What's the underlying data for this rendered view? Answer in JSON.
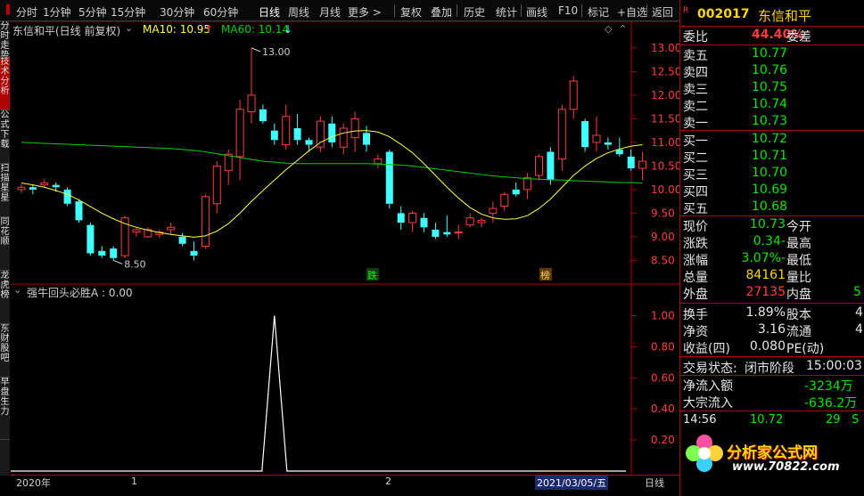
{
  "toolbar": {
    "items": [
      "分时",
      "1分钟",
      "5分钟",
      "15分钟",
      "30分钟",
      "60分钟",
      "日线",
      "周线",
      "月线",
      "更多 >",
      "复权",
      "叠加",
      "历史",
      "统计",
      "画线",
      "F10",
      "标记",
      "+自选",
      "返回"
    ],
    "active": "日线"
  },
  "sidebar": {
    "tabs": [
      "分时走势",
      "技术分析",
      "公式下载",
      "扫描星星",
      "同花顺",
      "龙虎榜",
      "东财股吧",
      "早盘生力"
    ]
  },
  "chart": {
    "title": "东信和平(日线 前复权)",
    "ma10_label": "MA10: 10.95",
    "ma10_arrow": "↑",
    "ma60_label": "MA60: 10.14",
    "ma60_arrow": "↓",
    "high_mark": "13.00",
    "low_mark": "8.50",
    "badge_die": "跌",
    "badge_bang": "榜",
    "y_ticks": [
      "13.00",
      "12.50",
      "12.00",
      "11.50",
      "11.00",
      "10.50",
      "10.00",
      "9.50",
      "9.00",
      "8.50"
    ],
    "indicator_title": "强牛回头必胜A : 0.00",
    "indicator_ticks": [
      "1.00",
      "0.80",
      "0.60",
      "0.40",
      "0.20"
    ],
    "bottom_labels": {
      "year": "2020年",
      "m1": "1",
      "m2": "2",
      "date": "2021/03/05/五",
      "period": "日线"
    },
    "colors": {
      "up": "#ff3c3c",
      "down": "#40ffff",
      "ma10": "#ffff40",
      "ma60": "#00d000"
    }
  },
  "chart_data": {
    "type": "candlestick",
    "ylim": [
      8.3,
      13.3
    ],
    "candles": [
      {
        "o": 10.0,
        "h": 10.12,
        "l": 9.93,
        "c": 10.05
      },
      {
        "o": 10.05,
        "h": 10.1,
        "l": 9.9,
        "c": 10.0
      },
      {
        "o": 10.1,
        "h": 10.22,
        "l": 10.05,
        "c": 10.14
      },
      {
        "o": 10.1,
        "h": 10.15,
        "l": 9.95,
        "c": 10.05
      },
      {
        "o": 10.0,
        "h": 10.05,
        "l": 9.65,
        "c": 9.7
      },
      {
        "o": 9.75,
        "h": 9.8,
        "l": 9.3,
        "c": 9.35
      },
      {
        "o": 9.25,
        "h": 9.3,
        "l": 8.6,
        "c": 8.65
      },
      {
        "o": 8.7,
        "h": 8.8,
        "l": 8.55,
        "c": 8.6
      },
      {
        "o": 8.75,
        "h": 8.8,
        "l": 8.5,
        "c": 8.55
      },
      {
        "o": 8.6,
        "h": 9.45,
        "l": 8.55,
        "c": 9.4
      },
      {
        "o": 9.1,
        "h": 9.2,
        "l": 9.0,
        "c": 9.15
      },
      {
        "o": 9.0,
        "h": 9.2,
        "l": 8.98,
        "c": 9.15
      },
      {
        "o": 9.05,
        "h": 9.15,
        "l": 8.98,
        "c": 9.1
      },
      {
        "o": 9.15,
        "h": 9.3,
        "l": 9.05,
        "c": 9.2
      },
      {
        "o": 9.0,
        "h": 9.08,
        "l": 8.8,
        "c": 8.85
      },
      {
        "o": 8.7,
        "h": 8.9,
        "l": 8.5,
        "c": 8.6
      },
      {
        "o": 8.8,
        "h": 9.9,
        "l": 8.75,
        "c": 9.85
      },
      {
        "o": 9.7,
        "h": 10.6,
        "l": 9.5,
        "c": 10.5
      },
      {
        "o": 10.4,
        "h": 10.85,
        "l": 10.1,
        "c": 10.75
      },
      {
        "o": 10.7,
        "h": 11.9,
        "l": 10.2,
        "c": 11.7
      },
      {
        "o": 11.65,
        "h": 13.0,
        "l": 11.4,
        "c": 12.0
      },
      {
        "o": 11.7,
        "h": 11.8,
        "l": 11.4,
        "c": 11.45
      },
      {
        "o": 11.25,
        "h": 11.4,
        "l": 10.95,
        "c": 11.05
      },
      {
        "o": 10.95,
        "h": 11.8,
        "l": 10.85,
        "c": 11.55
      },
      {
        "o": 11.3,
        "h": 11.6,
        "l": 10.95,
        "c": 11.05
      },
      {
        "o": 11.05,
        "h": 11.1,
        "l": 10.8,
        "c": 10.95
      },
      {
        "o": 10.9,
        "h": 11.55,
        "l": 10.8,
        "c": 11.45
      },
      {
        "o": 11.4,
        "h": 11.55,
        "l": 10.9,
        "c": 11.0
      },
      {
        "o": 10.9,
        "h": 11.4,
        "l": 10.75,
        "c": 11.3
      },
      {
        "o": 11.1,
        "h": 11.65,
        "l": 10.8,
        "c": 11.5
      },
      {
        "o": 11.2,
        "h": 11.35,
        "l": 10.8,
        "c": 10.95
      },
      {
        "o": 10.55,
        "h": 10.75,
        "l": 10.45,
        "c": 10.65
      },
      {
        "o": 10.8,
        "h": 10.85,
        "l": 9.6,
        "c": 9.7
      },
      {
        "o": 9.5,
        "h": 9.65,
        "l": 9.15,
        "c": 9.3
      },
      {
        "o": 9.3,
        "h": 9.55,
        "l": 9.1,
        "c": 9.5
      },
      {
        "o": 9.4,
        "h": 9.5,
        "l": 9.1,
        "c": 9.2
      },
      {
        "o": 9.15,
        "h": 9.3,
        "l": 8.95,
        "c": 9.0
      },
      {
        "o": 9.1,
        "h": 9.45,
        "l": 9.0,
        "c": 9.05
      },
      {
        "o": 9.1,
        "h": 9.25,
        "l": 8.95,
        "c": 9.1
      },
      {
        "o": 9.25,
        "h": 9.5,
        "l": 9.2,
        "c": 9.4
      },
      {
        "o": 9.3,
        "h": 9.4,
        "l": 9.2,
        "c": 9.35
      },
      {
        "o": 9.5,
        "h": 9.75,
        "l": 9.3,
        "c": 9.6
      },
      {
        "o": 9.65,
        "h": 9.95,
        "l": 9.55,
        "c": 9.9
      },
      {
        "o": 10.0,
        "h": 10.15,
        "l": 9.85,
        "c": 9.9
      },
      {
        "o": 10.0,
        "h": 10.35,
        "l": 9.8,
        "c": 10.25
      },
      {
        "o": 10.3,
        "h": 10.75,
        "l": 10.2,
        "c": 10.7
      },
      {
        "o": 10.8,
        "h": 10.9,
        "l": 10.1,
        "c": 10.2
      },
      {
        "o": 10.65,
        "h": 11.8,
        "l": 10.4,
        "c": 11.7
      },
      {
        "o": 11.7,
        "h": 12.4,
        "l": 11.5,
        "c": 12.3
      },
      {
        "o": 11.45,
        "h": 11.5,
        "l": 10.8,
        "c": 10.9
      },
      {
        "o": 11.0,
        "h": 11.55,
        "l": 10.8,
        "c": 11.15
      },
      {
        "o": 11.0,
        "h": 11.1,
        "l": 10.85,
        "c": 10.95
      },
      {
        "o": 10.85,
        "h": 11.1,
        "l": 10.7,
        "c": 10.75
      },
      {
        "o": 10.7,
        "h": 10.85,
        "l": 10.4,
        "c": 10.45
      },
      {
        "o": 10.45,
        "h": 10.8,
        "l": 10.2,
        "c": 10.6
      }
    ],
    "ma10": [
      10.14,
      10.1,
      10.05,
      9.98,
      9.9,
      9.78,
      9.64,
      9.5,
      9.38,
      9.28,
      9.2,
      9.14,
      9.09,
      9.05,
      9.02,
      8.99,
      9.02,
      9.12,
      9.28,
      9.5,
      9.75,
      9.98,
      10.2,
      10.42,
      10.62,
      10.82,
      11.0,
      11.12,
      11.2,
      11.24,
      11.25,
      11.22,
      11.12,
      10.96,
      10.78,
      10.55,
      10.3,
      10.05,
      9.82,
      9.62,
      9.48,
      9.4,
      9.37,
      9.38,
      9.45,
      9.6,
      9.8,
      10.05,
      10.3,
      10.5,
      10.66,
      10.78,
      10.86,
      10.92,
      10.95
    ],
    "ma60": [
      11.0,
      10.99,
      10.98,
      10.97,
      10.96,
      10.95,
      10.94,
      10.93,
      10.92,
      10.91,
      10.9,
      10.89,
      10.88,
      10.87,
      10.85,
      10.83,
      10.8,
      10.76,
      10.72,
      10.68,
      10.64,
      10.6,
      10.58,
      10.56,
      10.55,
      10.55,
      10.55,
      10.55,
      10.55,
      10.55,
      10.55,
      10.54,
      10.53,
      10.52,
      10.5,
      10.47,
      10.44,
      10.41,
      10.38,
      10.35,
      10.32,
      10.29,
      10.27,
      10.25,
      10.23,
      10.22,
      10.21,
      10.2,
      10.19,
      10.18,
      10.17,
      10.16,
      10.15,
      10.15,
      10.14
    ],
    "indicator": {
      "name": "强牛回头必胜A",
      "ylim": [
        0,
        1.1
      ],
      "values_nonzero_index": 22,
      "peak": 1.0
    }
  },
  "panel": {
    "code": "002017",
    "name": "东信和平",
    "r_mark": "R",
    "weibi_label": "委比",
    "weibi_value": "44.40%",
    "weicha_label": "委差",
    "sells": [
      {
        "label": "卖五",
        "price": "10.77"
      },
      {
        "label": "卖四",
        "price": "10.76"
      },
      {
        "label": "卖三",
        "price": "10.75"
      },
      {
        "label": "卖二",
        "price": "10.74"
      },
      {
        "label": "卖一",
        "price": "10.73"
      }
    ],
    "buys": [
      {
        "label": "买一",
        "price": "10.72"
      },
      {
        "label": "买二",
        "price": "10.71"
      },
      {
        "label": "买三",
        "price": "10.70"
      },
      {
        "label": "买四",
        "price": "10.69"
      },
      {
        "label": "买五",
        "price": "10.68"
      }
    ],
    "quote": [
      {
        "l": "现价",
        "v": "10.73",
        "r": "今开",
        "vc": "green"
      },
      {
        "l": "涨跌",
        "v": "-0.34",
        "r": "最高",
        "vc": "green"
      },
      {
        "l": "涨幅",
        "v": "-3.07%",
        "r": "最低",
        "vc": "green"
      },
      {
        "l": "总量",
        "v": "84161",
        "r": "量比",
        "vc": "yellow"
      },
      {
        "l": "外盘",
        "v": "27135",
        "r": "内盘",
        "vc": "red",
        "extra": "5"
      }
    ],
    "stats": [
      {
        "l": "换手",
        "v": "1.89%",
        "r": "股本",
        "extra": "4"
      },
      {
        "l": "净资",
        "v": "3.16",
        "r": "流通",
        "extra": "4"
      },
      {
        "l": "收益(四)",
        "v": "0.080",
        "r": "PE(动)",
        "extra": ""
      }
    ],
    "trade_status_label": "交易状态:",
    "trade_status_value": "闭市阶段",
    "trade_time": "15:00:03",
    "net_inflow_label": "净流入额",
    "net_inflow_value": "-3234万",
    "block_inflow_label": "大宗流入",
    "block_inflow_value": "-636.2万",
    "ticks": [
      {
        "t": "14:56",
        "p": "10.72",
        "v": "29",
        "flag": "S"
      }
    ],
    "watermark_title": "分析家公式网",
    "watermark_url": "www.70822.com"
  }
}
